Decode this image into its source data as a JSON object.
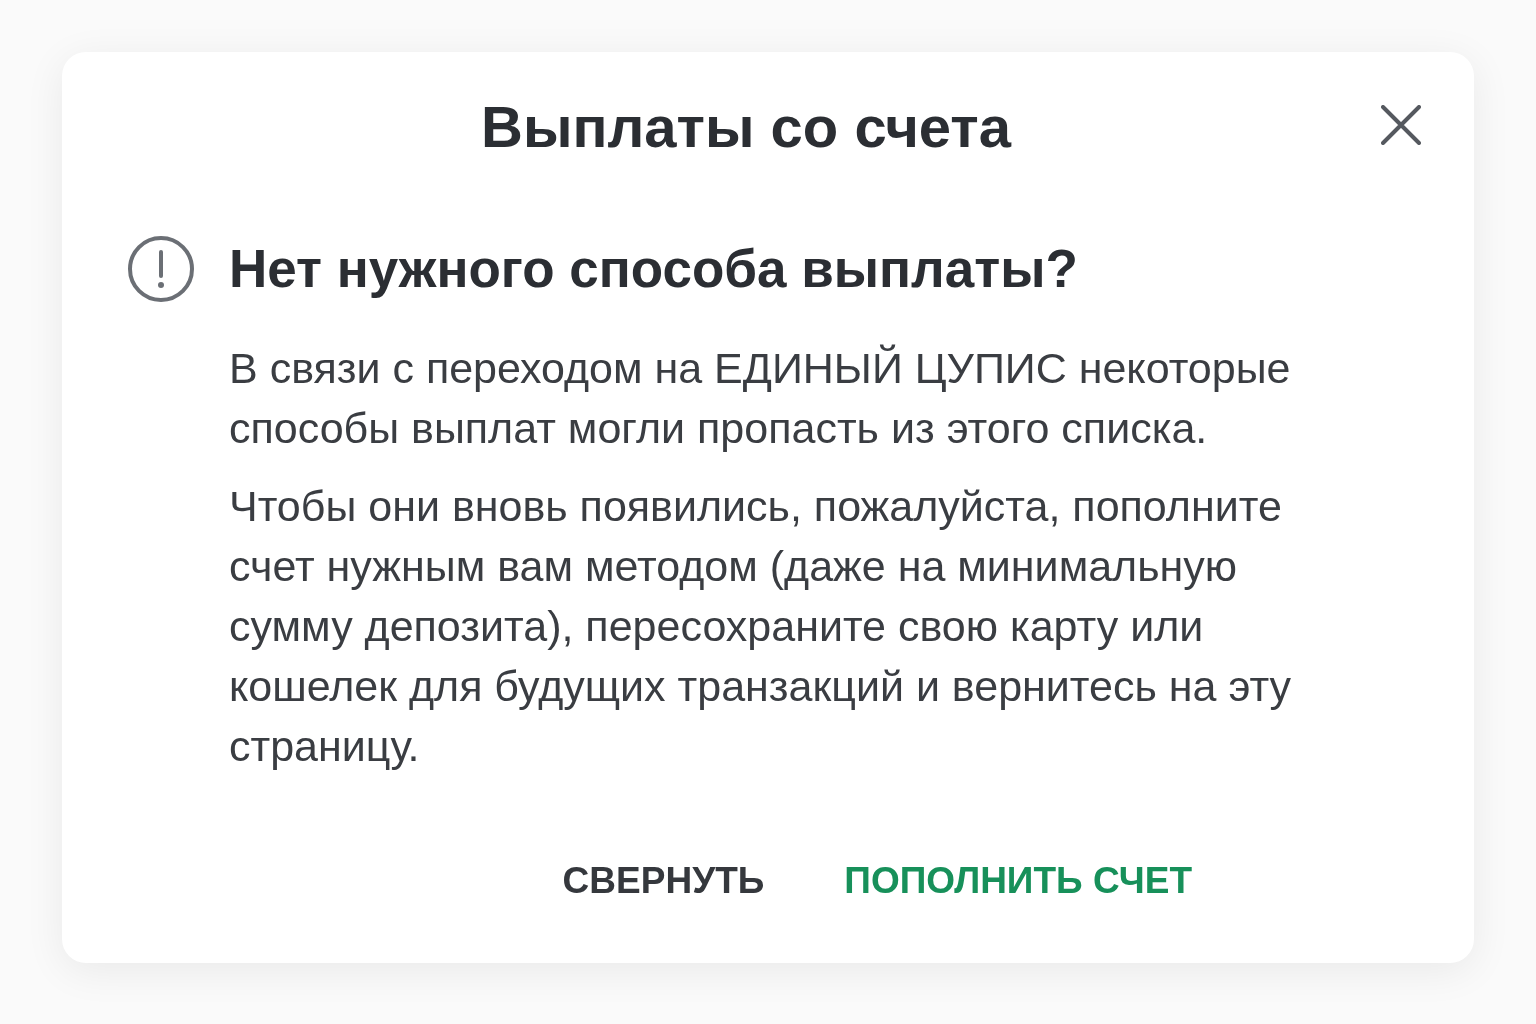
{
  "dialog": {
    "title": "Выплаты со счета",
    "notice": {
      "heading": "Нет нужного способа выплаты?",
      "paragraphs": [
        "В связи с переходом на ЕДИНЫЙ ЦУПИС некоторые способы выплат могли пропасть из этого списка.",
        "Чтобы они вновь появились, пожалуйста, пополните счет нужным вам методом (даже на минимальную сумму депозита), пересохраните свою карту или кошелек для будущих транзакций и вернитесь на эту страницу."
      ]
    },
    "buttons": [
      {
        "label": "СВЕРНУТЬ",
        "kind": "secondary"
      },
      {
        "label": "ПОПОЛНИТЬ СЧЕТ",
        "kind": "primary"
      }
    ]
  }
}
